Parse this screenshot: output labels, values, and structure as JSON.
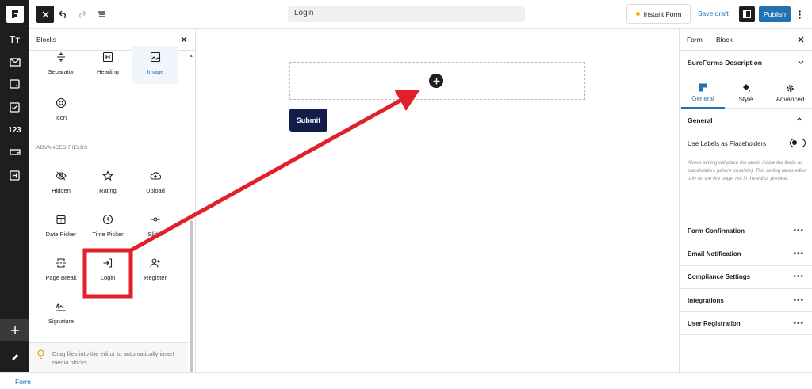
{
  "rail": {
    "text_icon": "Tт",
    "number_icon": "123"
  },
  "topbar": {
    "document_title": "Login",
    "instant_form_label": "Instant Form",
    "save_draft_label": "Save draft",
    "publish_label": "Publish"
  },
  "inserter": {
    "title": "Blocks",
    "top_blocks": [
      {
        "label": "Separator",
        "icon": "separator-icon"
      },
      {
        "label": "Heading",
        "icon": "heading-icon"
      },
      {
        "label": "Image",
        "icon": "image-icon",
        "selected": true
      },
      {
        "label": "Icon",
        "icon": "target-icon"
      }
    ],
    "section_label": "ADVANCED FIELDS",
    "advanced_blocks": [
      {
        "label": "Hidden",
        "icon": "eye-off-icon"
      },
      {
        "label": "Rating",
        "icon": "star-icon"
      },
      {
        "label": "Upload",
        "icon": "cloud-upload-icon"
      },
      {
        "label": "Date Picker",
        "icon": "calendar-icon"
      },
      {
        "label": "Time Picker",
        "icon": "clock-icon"
      },
      {
        "label": "Slider",
        "icon": "slider-icon"
      },
      {
        "label": "Page Break",
        "icon": "page-break-icon"
      },
      {
        "label": "Login",
        "icon": "login-icon"
      },
      {
        "label": "Register",
        "icon": "user-plus-icon"
      },
      {
        "label": "Signature",
        "icon": "signature-icon"
      }
    ],
    "footer_tip": "Drag files into the editor to automatically insert media blocks."
  },
  "canvas": {
    "submit_label": "Submit"
  },
  "settings": {
    "tabs": [
      "Form",
      "Block"
    ],
    "description_label": "SureForms Description",
    "subtabs": [
      {
        "label": "General",
        "icon": "general-icon"
      },
      {
        "label": "Style",
        "icon": "paint-bucket-icon"
      },
      {
        "label": "Advanced",
        "icon": "gear-icon"
      }
    ],
    "general_heading": "General",
    "toggle_label": "Use Labels as Placeholders",
    "toggle_on": false,
    "help_text": "Above setting will place the labels inside the fields as placeholders (where possible). This setting takes effect only on the live page, not in the editor preview.",
    "sections": [
      "Form Confirmation",
      "Email Notification",
      "Compliance Settings",
      "Integrations",
      "User Registration"
    ]
  },
  "bottombar": {
    "breadcrumb": "Form"
  },
  "colors": {
    "accent": "#2271b1",
    "submit": "#131d4a",
    "annotation": "#e3202a",
    "dark": "#1e1e1e"
  }
}
